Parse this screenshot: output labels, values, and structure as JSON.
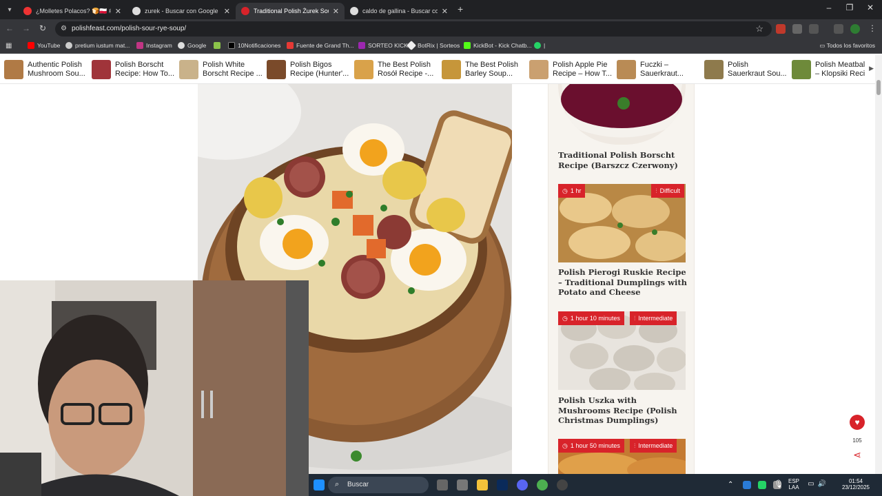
{
  "browser": {
    "tabs": [
      {
        "title": "¿Molletes Polacos? 🍞🇵🇱 #craco",
        "favicon_color": "#e33",
        "active": false
      },
      {
        "title": "zurek - Buscar con Google",
        "favicon_color": "#ddd",
        "active": false
      },
      {
        "title": "Traditional Polish Żurek Sour Ry",
        "favicon_color": "#d8232a",
        "active": true
      },
      {
        "title": "caldo de gallina - Buscar con Go",
        "favicon_color": "#ddd",
        "active": false
      }
    ],
    "new_tab_label": "+",
    "url": "polishfeast.com/polish-sour-rye-soup/",
    "bookmarks": [
      {
        "label": "YouTube",
        "color": "#ff0000"
      },
      {
        "label": "pretium iustum mat...",
        "color": "#ccc"
      },
      {
        "label": "Instagram",
        "color": "#c13584"
      },
      {
        "label": "Google",
        "color": "#ddd"
      },
      {
        "label": "",
        "color": "#8bc34a"
      },
      {
        "label": "10Notificaciones",
        "color": "#000"
      },
      {
        "label": "Fuente de Grand Th...",
        "color": "#e53935"
      },
      {
        "label": "SORTEO KICK",
        "color": "#9c27b0"
      },
      {
        "label": "BotRix | Sorteos",
        "color": "#eee"
      },
      {
        "label": "KickBot - Kick Chatb...",
        "color": "#53fc18"
      },
      {
        "label": "|",
        "color": "#25d366"
      }
    ],
    "all_favorites_label": "Todos los favoritos"
  },
  "related": [
    {
      "line1": "Authentic Polish",
      "line2": "Mushroom Sou...",
      "color": "#b07a45"
    },
    {
      "line1": "Polish Borscht",
      "line2": "Recipe: How To...",
      "color": "#a0343a"
    },
    {
      "line1": "Polish White",
      "line2": "Borscht Recipe ...",
      "color": "#c9b28a"
    },
    {
      "line1": "Polish Bigos",
      "line2": "Recipe (Hunter'...",
      "color": "#7a4a2a"
    },
    {
      "line1": "The Best Polish",
      "line2": "Rosół Recipe -...",
      "color": "#d9a24a"
    },
    {
      "line1": "The Best Polish",
      "line2": "Barley Soup...",
      "color": "#c6963a"
    },
    {
      "line1": "Polish Apple Pie",
      "line2": "Recipe – How T...",
      "color": "#caa070"
    },
    {
      "line1": "Fuczki –",
      "line2": "Sauerkraut...",
      "color": "#b98b55"
    },
    {
      "line1": "Polish",
      "line2": "Sauerkraut Sou...",
      "color": "#8e7a4c"
    },
    {
      "line1": "Polish Meatbal",
      "line2": "– Klopsiki Reci",
      "color": "#6e8a3a"
    }
  ],
  "sidebar": {
    "cards": [
      {
        "title": "Traditional Polish Borscht Recipe (Barszcz Czerwony)",
        "time": "",
        "difficulty": ""
      },
      {
        "title": "Polish Pierogi Ruskie Recipe – Traditional Dumplings with Potato and Cheese",
        "time": "1 hr",
        "difficulty": "Difficult"
      },
      {
        "title": "Polish Uszka with Mushrooms Recipe (Polish Christmas Dumplings)",
        "time": "1 hour 10 minutes",
        "difficulty": "Intermediate"
      },
      {
        "title": "",
        "time": "1 hour 50 minutes",
        "difficulty": "Intermediate"
      }
    ]
  },
  "float": {
    "count": "105"
  },
  "taskbar": {
    "search_label": "Buscar",
    "lang_top": "ESP",
    "lang_bottom": "LAA",
    "time": "01:54",
    "date": "23/12/2025"
  },
  "colors": {
    "accent": "#d8232a",
    "chrome_dark": "#202124",
    "chrome_mid": "#35363a"
  }
}
